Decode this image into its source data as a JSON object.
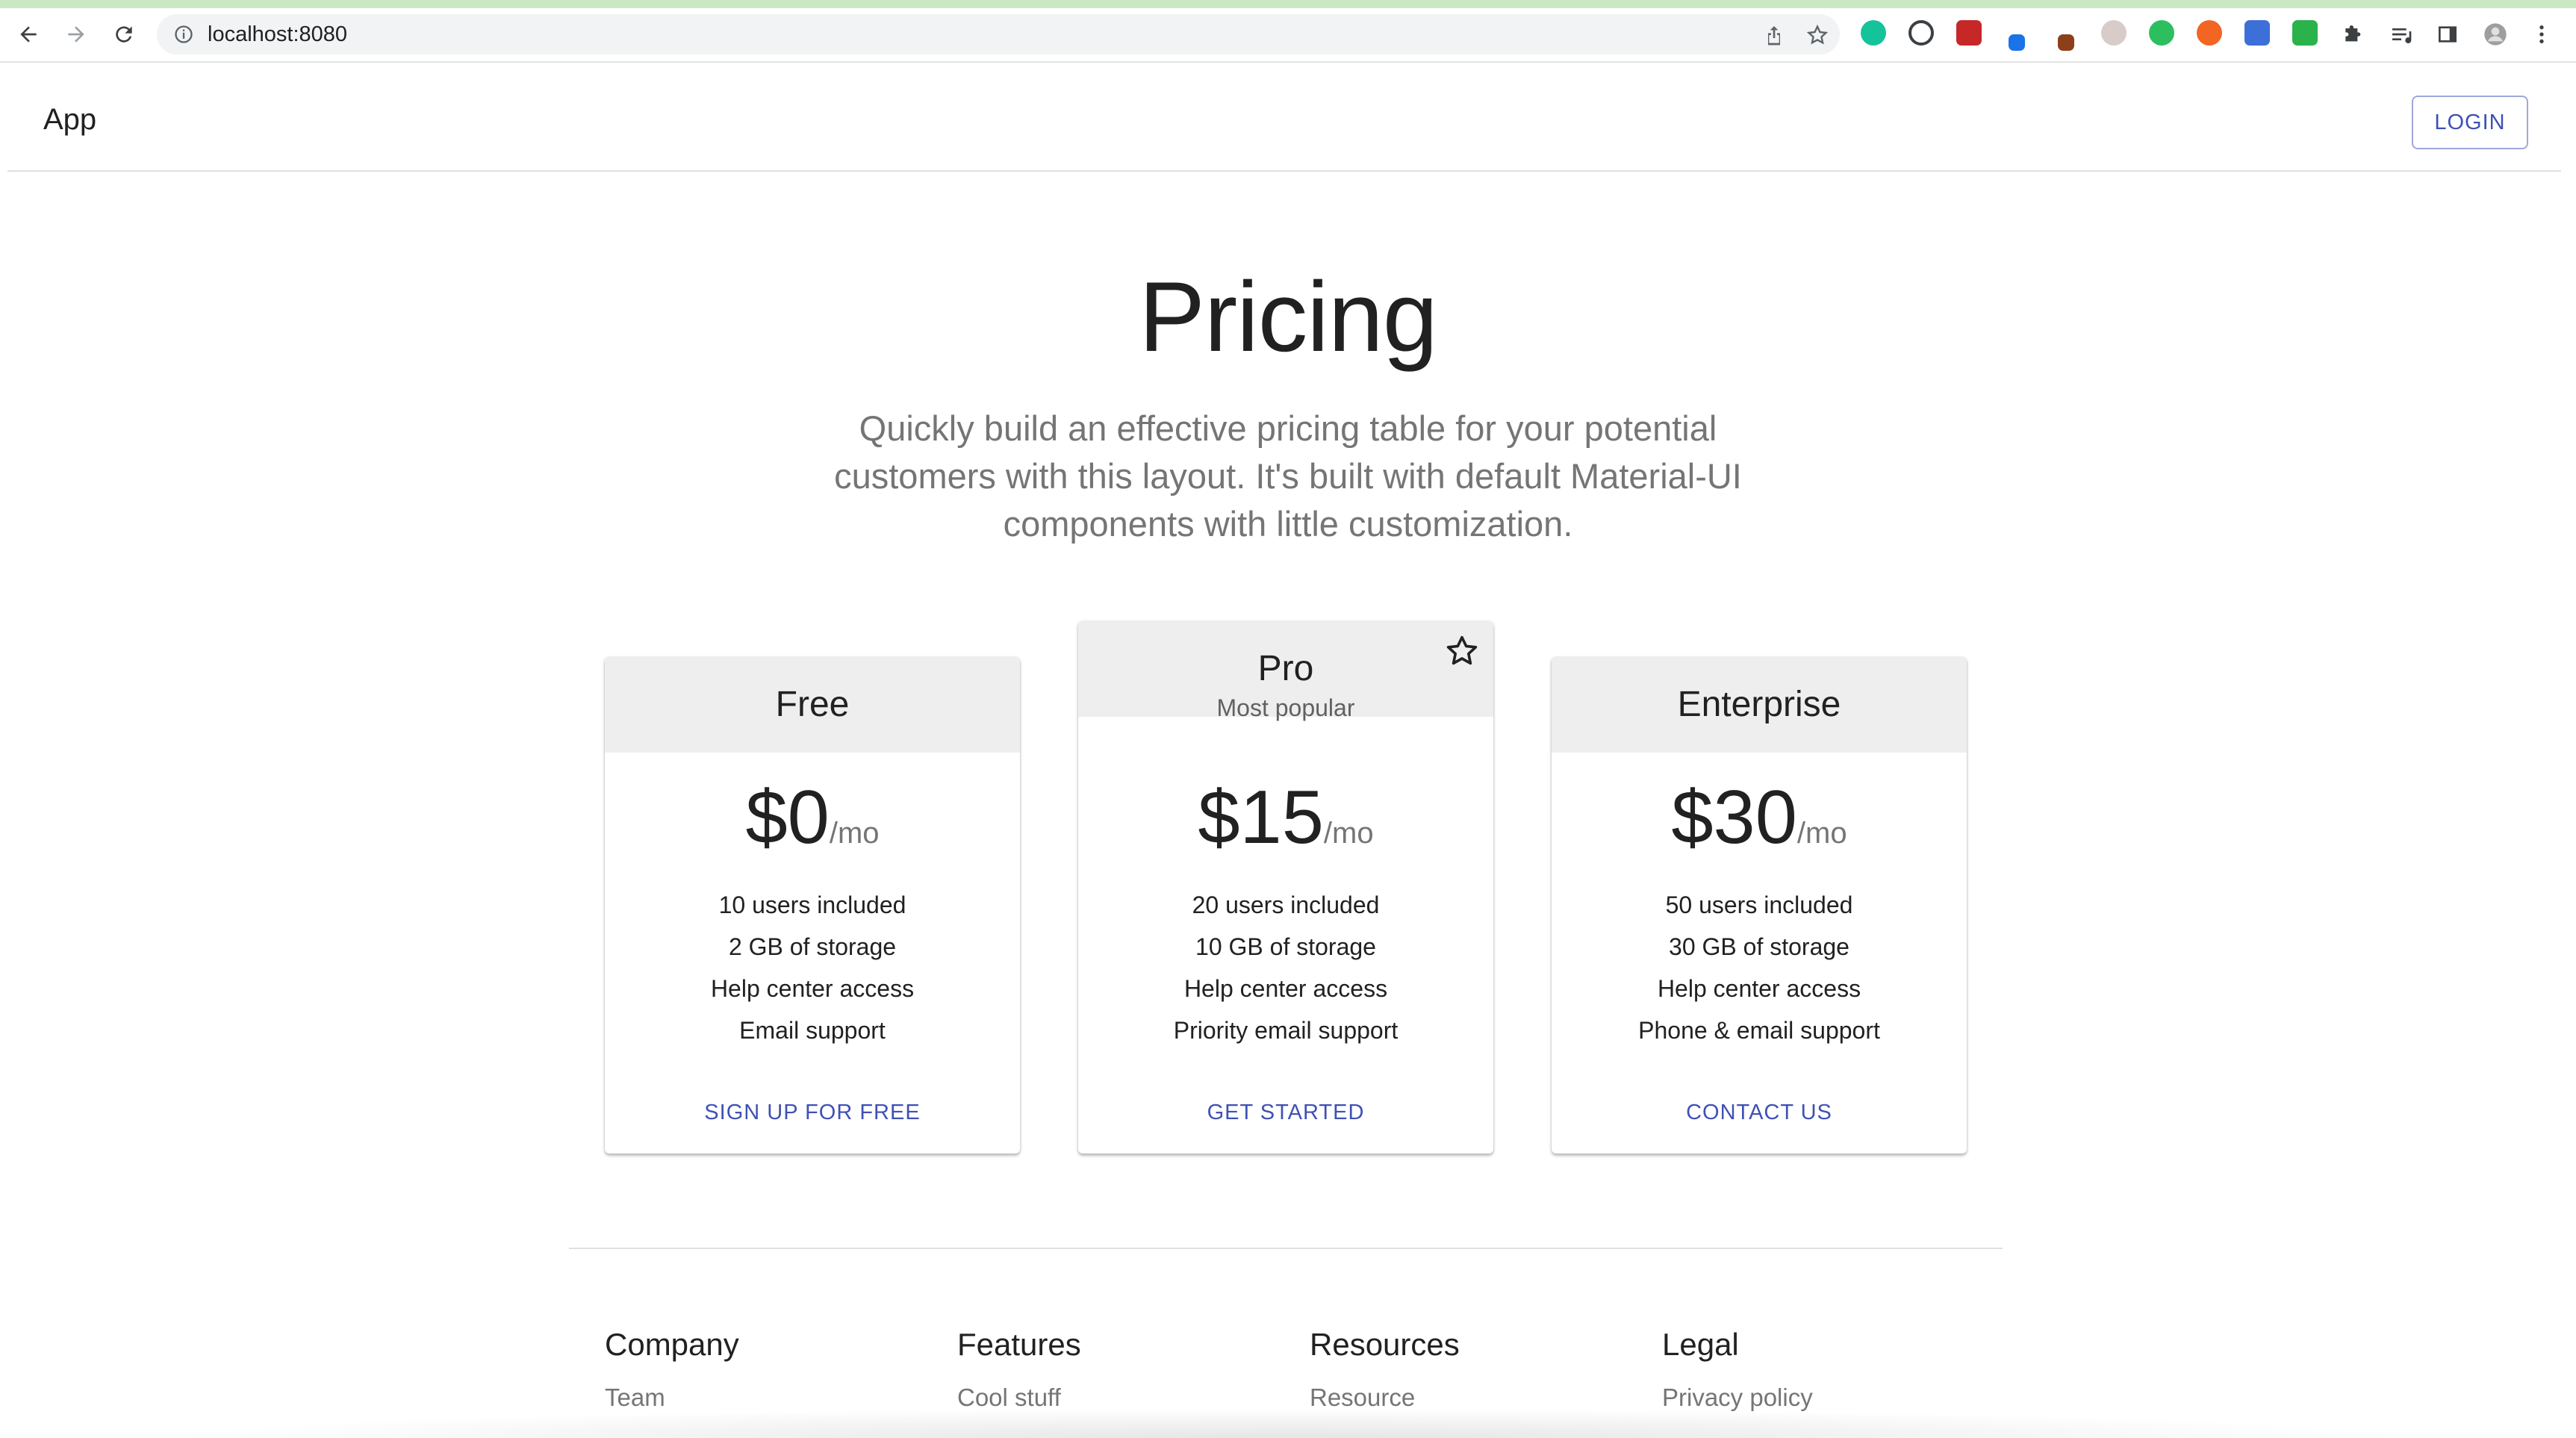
{
  "browser": {
    "url": "localhost:8080",
    "icons": {
      "back": "back-arrow-icon",
      "forward": "forward-arrow-icon",
      "reload": "reload-icon",
      "info": "info-icon",
      "share": "share-icon",
      "bookmark": "bookmark-star-icon",
      "extensions": "puzzle-icon",
      "reading_list": "reading-list-icon",
      "side_panel": "side-panel-icon",
      "profile": "profile-avatar",
      "menu": "kebab-menu-icon"
    }
  },
  "app_bar": {
    "title": "App",
    "login_label": "LOGIN"
  },
  "hero": {
    "title": "Pricing",
    "subtitle": "Quickly build an effective pricing table for your potential customers with this layout. It's built with default Material-UI components with little customization."
  },
  "tiers": [
    {
      "title": "Free",
      "subheader": "",
      "price": "$0",
      "period": "/mo",
      "features": [
        "10 users included",
        "2 GB of storage",
        "Help center access",
        "Email support"
      ],
      "button": "SIGN UP FOR FREE"
    },
    {
      "title": "Pro",
      "subheader": "Most popular",
      "price": "$15",
      "period": "/mo",
      "features": [
        "20 users included",
        "10 GB of storage",
        "Help center access",
        "Priority email support"
      ],
      "button": "GET STARTED"
    },
    {
      "title": "Enterprise",
      "subheader": "",
      "price": "$30",
      "period": "/mo",
      "features": [
        "50 users included",
        "30 GB of storage",
        "Help center access",
        "Phone & email support"
      ],
      "button": "CONTACT US"
    }
  ],
  "footer": [
    {
      "title": "Company",
      "items": [
        "Team"
      ]
    },
    {
      "title": "Features",
      "items": [
        "Cool stuff"
      ]
    },
    {
      "title": "Resources",
      "items": [
        "Resource"
      ]
    },
    {
      "title": "Legal",
      "items": [
        "Privacy policy"
      ]
    }
  ],
  "colors": {
    "primary": "#3f51b5",
    "header_bg": "#eeeeee",
    "secondary_text": "#757575"
  }
}
